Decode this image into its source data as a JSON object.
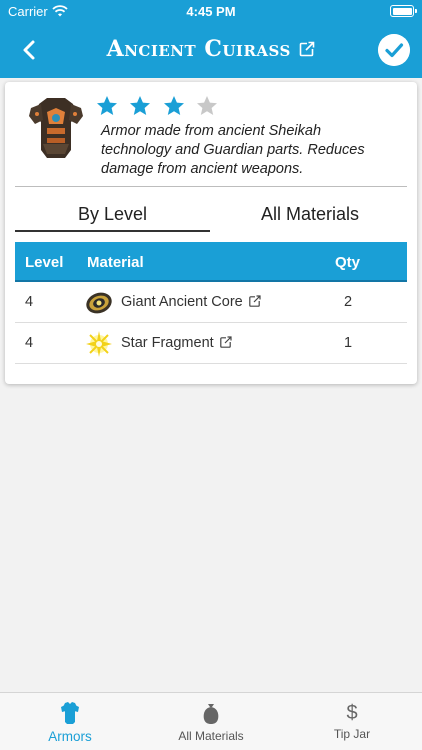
{
  "status_bar": {
    "carrier": "Carrier",
    "time": "4:45 PM"
  },
  "nav": {
    "title": "Ancient Cuirass",
    "back_icon": "chevron-left-icon",
    "done_icon": "checkmark-circle-icon"
  },
  "armor": {
    "stars_filled": 3,
    "stars_total": 4,
    "description": "Armor made from ancient Sheikah technology and Guardian parts. Reduces damage from ancient weapons."
  },
  "tabs": {
    "by_level": "By Level",
    "all_materials": "All Materials",
    "selected": "By Level"
  },
  "table": {
    "headers": {
      "level": "Level",
      "material": "Material",
      "qty": "Qty"
    },
    "rows": [
      {
        "level": "4",
        "material": "Giant Ancient Core",
        "qty": "2",
        "icon": "ancient-core-icon"
      },
      {
        "level": "4",
        "material": "Star Fragment",
        "qty": "1",
        "icon": "star-fragment-icon"
      }
    ]
  },
  "tab_bar": {
    "items": [
      {
        "label": "Armors",
        "icon": "armor-icon",
        "active": true
      },
      {
        "label": "All Materials",
        "icon": "material-bag-icon",
        "active": false
      },
      {
        "label": "Tip Jar",
        "icon": "dollar-icon",
        "active": false
      }
    ]
  },
  "colors": {
    "accent": "#1a9fd6",
    "star_filled": "#1a9fd6",
    "star_empty": "#c8c8c8"
  }
}
